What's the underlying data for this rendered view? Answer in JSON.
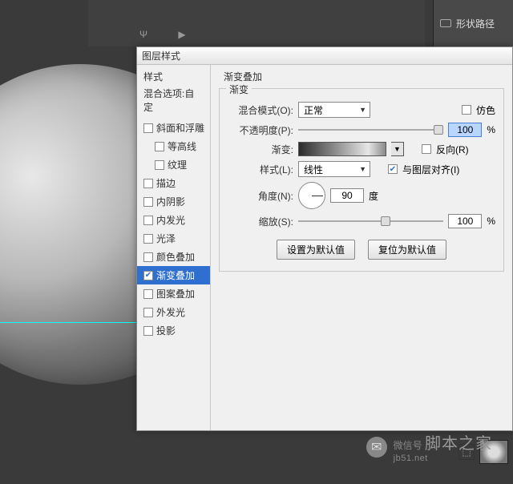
{
  "app": {
    "shape_path_label": "形状路径"
  },
  "dialog": {
    "title": "图层样式"
  },
  "styles": {
    "header": "样式",
    "blend_options": "混合选项:自定",
    "items": [
      {
        "label": "斜面和浮雕",
        "checked": false,
        "indent": false
      },
      {
        "label": "等高线",
        "checked": false,
        "indent": true
      },
      {
        "label": "纹理",
        "checked": false,
        "indent": true
      },
      {
        "label": "描边",
        "checked": false,
        "indent": false
      },
      {
        "label": "内阴影",
        "checked": false,
        "indent": false
      },
      {
        "label": "内发光",
        "checked": false,
        "indent": false
      },
      {
        "label": "光泽",
        "checked": false,
        "indent": false
      },
      {
        "label": "颜色叠加",
        "checked": false,
        "indent": false
      },
      {
        "label": "渐变叠加",
        "checked": true,
        "indent": false,
        "selected": true
      },
      {
        "label": "图案叠加",
        "checked": false,
        "indent": false
      },
      {
        "label": "外发光",
        "checked": false,
        "indent": false
      },
      {
        "label": "投影",
        "checked": false,
        "indent": false
      }
    ]
  },
  "panel": {
    "title": "渐变叠加",
    "group": "渐变",
    "blend_mode_label": "混合模式(O):",
    "blend_mode_value": "正常",
    "dither_label": "仿色",
    "dither_checked": false,
    "opacity_label": "不透明度(P):",
    "opacity_value": "100",
    "opacity_unit": "%",
    "gradient_label": "渐变:",
    "reverse_label": "反向(R)",
    "reverse_checked": false,
    "style_label": "样式(L):",
    "style_value": "线性",
    "align_label": "与图层对齐(I)",
    "align_checked": true,
    "angle_label": "角度(N):",
    "angle_value": "90",
    "angle_unit": "度",
    "scale_label": "缩放(S):",
    "scale_value": "100",
    "scale_unit": "%",
    "btn_default": "设置为默认值",
    "btn_reset": "复位为默认值"
  },
  "watermark": {
    "prefix": "微信号",
    "site": "jb51.net",
    "name": "脚本之家"
  }
}
